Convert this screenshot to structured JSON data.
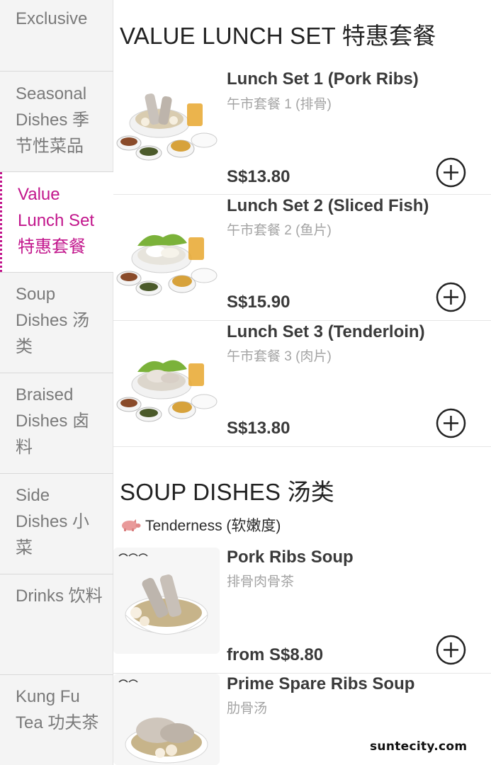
{
  "sidebar": {
    "items": [
      {
        "label": "Exclusive",
        "active": false
      },
      {
        "label": "Seasonal Dishes 季节性菜品",
        "active": false
      },
      {
        "label": "Value Lunch Set 特惠套餐",
        "active": true
      },
      {
        "label": "Soup Dishes 汤类",
        "active": false
      },
      {
        "label": "Braised Dishes 卤料",
        "active": false
      },
      {
        "label": "Side Dishes 小菜",
        "active": false
      },
      {
        "label": "Drinks 饮料",
        "active": false
      },
      {
        "label": "Kung Fu Tea 功夫茶",
        "active": false
      }
    ]
  },
  "sections": {
    "lunch": {
      "title": "VALUE LUNCH SET 特惠套餐",
      "items": [
        {
          "name": "Lunch Set 1 (Pork Ribs)",
          "cname": "午市套餐 1 (排骨)",
          "price": "S$13.80",
          "image": "pork-ribs-set-image"
        },
        {
          "name": "Lunch Set 2 (Sliced Fish)",
          "cname": "午市套餐 2 (鱼片)",
          "price": "S$15.90",
          "image": "sliced-fish-set-image"
        },
        {
          "name": "Lunch Set 3 (Tenderloin)",
          "cname": "午市套餐 3 (肉片)",
          "price": "S$13.80",
          "image": "tenderloin-set-image"
        }
      ]
    },
    "soup": {
      "title": "SOUP DISHES 汤类",
      "tenderness_label": "Tenderness (软嫩度)",
      "items": [
        {
          "name": "Pork Ribs Soup",
          "cname": "排骨肉骨茶",
          "price": "from S$8.80",
          "tenderness": 3,
          "image": "pork-ribs-soup-image"
        },
        {
          "name": "Prime Spare Ribs Soup",
          "cname": "肋骨汤",
          "price": "",
          "tenderness": 2,
          "image": "prime-spare-ribs-soup-image"
        }
      ]
    }
  },
  "watermark": "suntecity.com",
  "colors": {
    "accent": "#c2168c",
    "text": "#3a3a3a",
    "muted": "#a4a4a4"
  }
}
